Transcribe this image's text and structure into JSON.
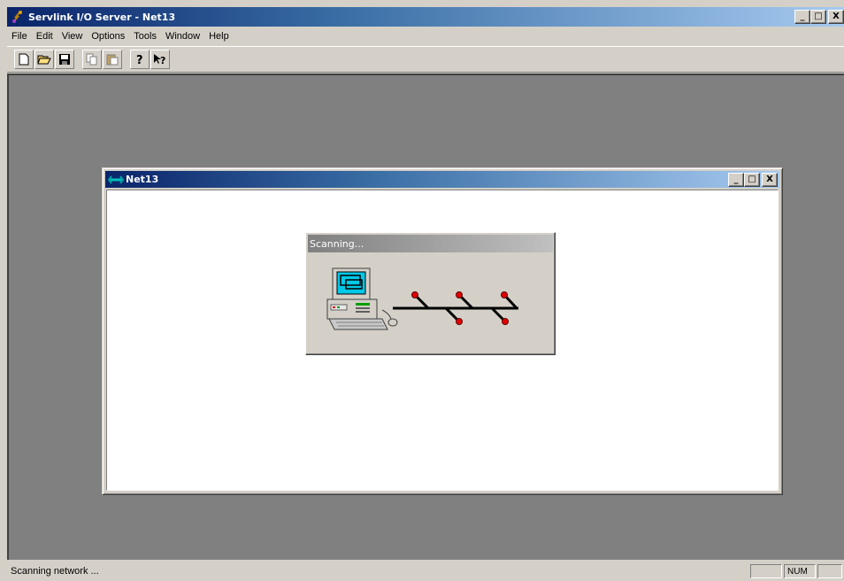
{
  "app": {
    "title": "Servlink I/O Server - Net13",
    "icon": "servlink-app-icon"
  },
  "window_controls": {
    "minimize": "_",
    "maximize": "□",
    "close": "X"
  },
  "menu": {
    "items": [
      "File",
      "Edit",
      "View",
      "Options",
      "Tools",
      "Window",
      "Help"
    ]
  },
  "toolbar": {
    "buttons": [
      "new-icon",
      "open-icon",
      "save-icon",
      "copy-icon",
      "paste-icon",
      "about-icon",
      "context-help-icon"
    ]
  },
  "child_window": {
    "title": "Net13",
    "icon": "network-icon"
  },
  "scan_dialog": {
    "title": "Scanning...",
    "illustration": "network-scan-icon"
  },
  "status": {
    "text": "Scanning network ...",
    "num": "NUM"
  },
  "colors": {
    "titlebar_start": "#0a246a",
    "titlebar_end": "#a6caf0",
    "mdi_background": "#808080",
    "face": "#d4d0c8",
    "node_red": "#e00000"
  }
}
